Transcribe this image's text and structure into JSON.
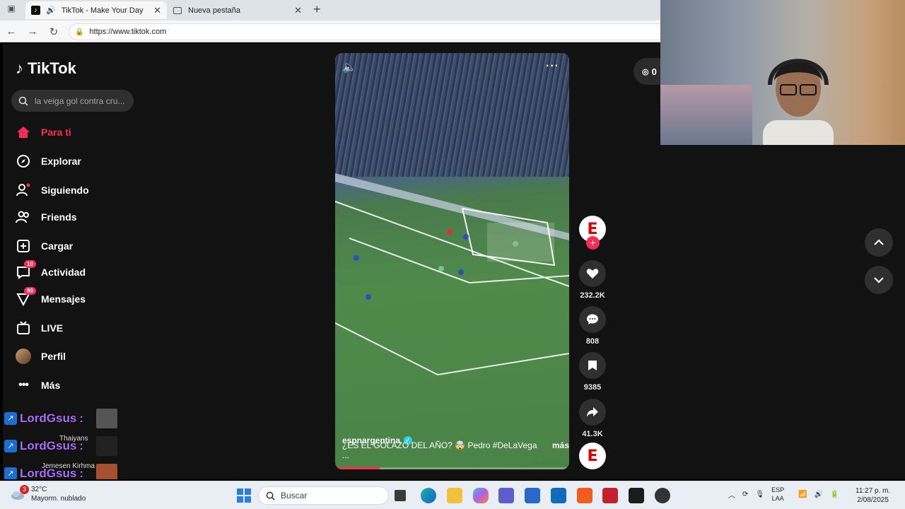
{
  "browser": {
    "tabs": [
      {
        "title": "TikTok - Make Your Day",
        "active": true
      },
      {
        "title": "Nueva pestaña",
        "active": false
      }
    ],
    "url": "https://www.tiktok.com"
  },
  "tiktok": {
    "logo_text": "TikTok",
    "search_placeholder": "la veiga gol contra cru...",
    "nav": [
      {
        "label": "Para ti",
        "icon": "home-icon",
        "active": true
      },
      {
        "label": "Explorar",
        "icon": "compass-icon"
      },
      {
        "label": "Siguiendo",
        "icon": "following-icon"
      },
      {
        "label": "Friends",
        "icon": "friends-icon"
      },
      {
        "label": "Cargar",
        "icon": "upload-icon"
      },
      {
        "label": "Actividad",
        "icon": "activity-icon",
        "badge": "10"
      },
      {
        "label": "Mensajes",
        "icon": "messages-icon",
        "badge": "99"
      },
      {
        "label": "LIVE",
        "icon": "live-icon"
      },
      {
        "label": "Perfil",
        "icon": "profile-avatar"
      },
      {
        "label": "Más",
        "icon": "more-icon"
      }
    ],
    "coins": "0",
    "video": {
      "username": "espnargentina",
      "caption": "¿ES EL GOLAZO DEL AÑO? 🤯 Pedro #DeLaVega ...",
      "more_label": "más",
      "progress": 0.19
    },
    "actions": {
      "likes": "232.2K",
      "comments": "808",
      "saves": "9385",
      "shares": "41.3K"
    }
  },
  "chat": {
    "username": "LordGsus",
    "separator": ":",
    "ghost_lines": [
      "Thaiyans",
      "Jemesen Kirhma"
    ]
  },
  "taskbar": {
    "weather_temp": "32°C",
    "weather_desc": "Mayorm. nublado",
    "weather_badge": "3",
    "search_label": "Buscar",
    "lang_line1": "ESP",
    "lang_line2": "LAA",
    "time": "11:27 p. m.",
    "date": "2/08/2025"
  },
  "colors": {
    "accent": "#fe2c55",
    "chat_name": "#b06cff"
  }
}
